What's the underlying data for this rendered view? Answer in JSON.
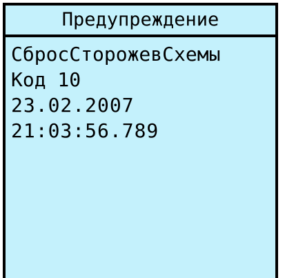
{
  "dialog": {
    "title": "Предупреждение",
    "lines": [
      "СбросСторожевСхемы",
      "Код 10",
      "23.02.2007",
      "21:03:56.789"
    ]
  },
  "colors": {
    "background": "#c4f1fc",
    "text": "#000000",
    "border": "#000000"
  }
}
